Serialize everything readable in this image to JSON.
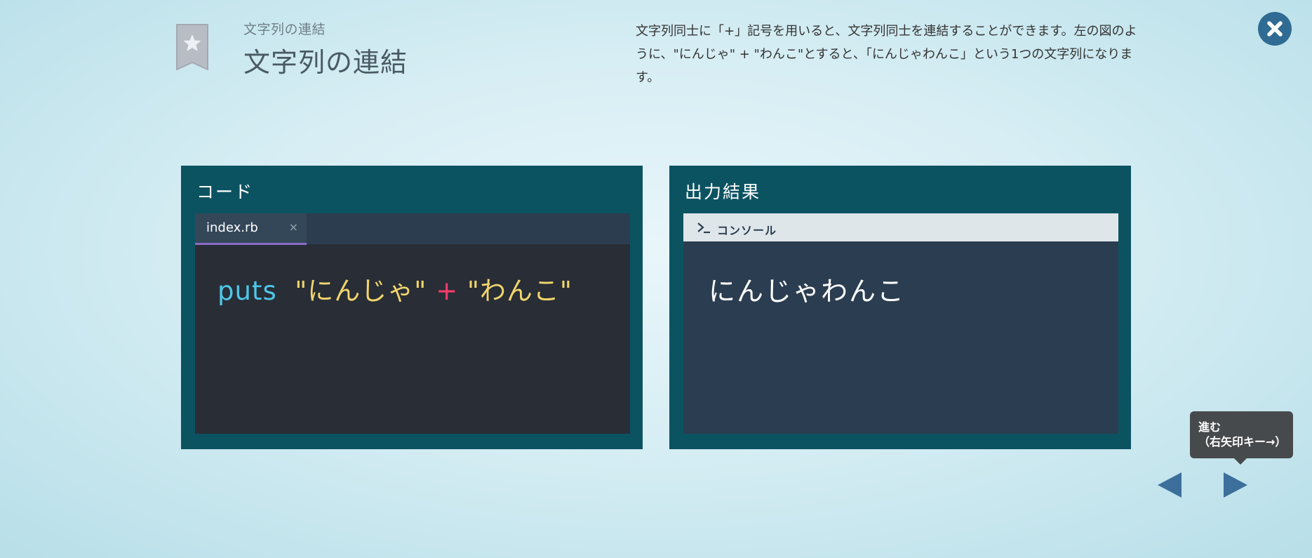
{
  "header": {
    "subtitle": "文字列の連結",
    "title": "文字列の連結",
    "description_line1": "文字列同士に「+」記号を用いると、文字列同士を連結することができます。左の図のよ",
    "description_line2": "うに、\"にんじゃ\" + \"わんこ\"とすると、「にんじゃわんこ」という1つの文字列になります。"
  },
  "code_panel": {
    "heading": "コード",
    "tab_name": "index.rb",
    "tab_close": "×",
    "code": {
      "keyword": "puts",
      "string1": "\"にんじゃ\"",
      "operator": "+",
      "string2": "\"わんこ\""
    }
  },
  "output_panel": {
    "heading": "出力結果",
    "console_label": "コンソール",
    "output": "にんじゃわんこ"
  },
  "navigation": {
    "tooltip_line1": "進む",
    "tooltip_line2": "（右矢印キー→）"
  },
  "icons": {
    "bookmark": "star-bookmark-icon",
    "close": "close-icon",
    "console": "terminal-prompt-icon",
    "prev": "triangle-left-icon",
    "next": "triangle-right-icon"
  },
  "colors": {
    "panel_bg": "#0c5362",
    "editor_bg": "#282d36",
    "console_bg": "#2b3d50",
    "keyword": "#4fc6e8",
    "string": "#f1d56c",
    "operator": "#ff3b6a",
    "accent_button": "#2f6b92"
  }
}
